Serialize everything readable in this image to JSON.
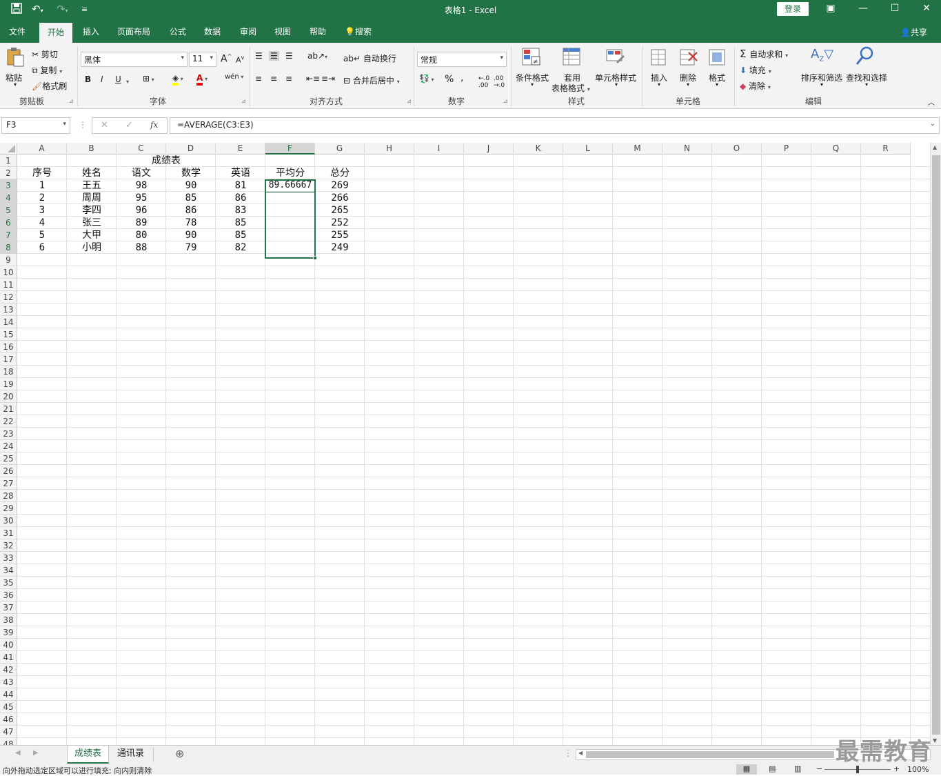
{
  "window": {
    "title": "表格1  -  Excel",
    "login_label": "登录"
  },
  "tabs": [
    "文件",
    "开始",
    "插入",
    "页面布局",
    "公式",
    "数据",
    "审阅",
    "视图",
    "帮助",
    "搜索"
  ],
  "share_label": "共享",
  "ribbon": {
    "clipboard": {
      "paste": "粘贴",
      "cut": "剪切",
      "copy": "复制",
      "format_painter": "格式刷",
      "label": "剪贴板"
    },
    "font": {
      "name": "黑体",
      "size": "11",
      "bold": "B",
      "italic": "I",
      "underline": "U",
      "label": "字体",
      "grow": "A",
      "shrink": "A"
    },
    "alignment": {
      "wrap": "自动换行",
      "merge": "合并后居中",
      "label": "对齐方式"
    },
    "number": {
      "format": "常规",
      "percent": "%",
      "comma": ",",
      "label": "数字"
    },
    "styles": {
      "conditional": "条件格式",
      "table1": "套用",
      "table2": "表格格式",
      "cell_styles": "单元格样式",
      "label": "样式"
    },
    "cells": {
      "insert": "插入",
      "delete": "删除",
      "format": "格式",
      "label": "单元格"
    },
    "editing": {
      "autosum": "自动求和",
      "fill": "填充",
      "clear": "清除",
      "sort": "排序和筛选",
      "find": "查找和选择",
      "label": "编辑"
    }
  },
  "formula_bar": {
    "name_box": "F3",
    "fx": "fx",
    "formula": "=AVERAGE(C3:E3)"
  },
  "columns": [
    "A",
    "B",
    "C",
    "D",
    "E",
    "F",
    "G",
    "H",
    "I",
    "J",
    "K",
    "L",
    "M",
    "N",
    "O",
    "P",
    "Q",
    "R"
  ],
  "rows": [
    "1",
    "2",
    "3",
    "4",
    "5",
    "6",
    "7",
    "8",
    "9",
    "10",
    "11",
    "12",
    "13",
    "14",
    "15",
    "16",
    "17",
    "18",
    "19",
    "20",
    "21",
    "22",
    "23",
    "24",
    "25",
    "26",
    "27",
    "28",
    "29",
    "30",
    "31",
    "32",
    "33",
    "34",
    "35",
    "36",
    "37",
    "38",
    "39",
    "40",
    "41",
    "42",
    "43",
    "44",
    "45",
    "46",
    "47",
    "48"
  ],
  "sheet": {
    "title": "成绩表",
    "headers": [
      "序号",
      "姓名",
      "语文",
      "数学",
      "英语",
      "平均分",
      "总分"
    ],
    "data": [
      [
        "1",
        "王五",
        "98",
        "90",
        "81",
        "89.66667",
        "269"
      ],
      [
        "2",
        "周周",
        "95",
        "85",
        "86",
        "",
        "266"
      ],
      [
        "3",
        "李四",
        "96",
        "86",
        "83",
        "",
        "265"
      ],
      [
        "4",
        "张三",
        "89",
        "78",
        "85",
        "",
        "252"
      ],
      [
        "5",
        "大甲",
        "80",
        "90",
        "85",
        "",
        "255"
      ],
      [
        "6",
        "小明",
        "88",
        "79",
        "82",
        "",
        "249"
      ]
    ]
  },
  "sheet_tabs": [
    "成绩表",
    "通讯录"
  ],
  "status": {
    "message": "向外拖动选定区域可以进行填充; 向内则清除",
    "zoom": "100%"
  },
  "watermark": "最需教育"
}
